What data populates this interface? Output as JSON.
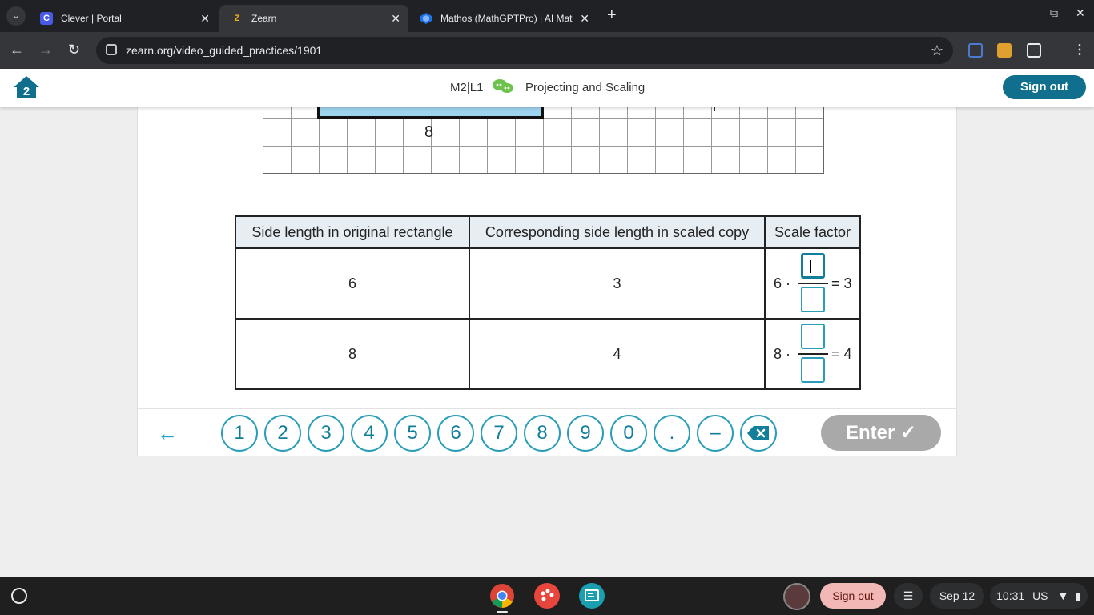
{
  "browser": {
    "tabs": [
      {
        "title": "Clever | Portal",
        "icon": "clever-icon",
        "active": false
      },
      {
        "title": "Zearn",
        "icon": "zearn-icon",
        "active": true
      },
      {
        "title": "Mathos (MathGPTPro) | AI Mat",
        "icon": "mathos-icon",
        "active": false
      }
    ],
    "url": "zearn.org/video_guided_practices/1901"
  },
  "header": {
    "lesson_code": "M2|L1",
    "lesson_title": "Projecting and Scaling",
    "sign_out": "Sign out"
  },
  "figure": {
    "bottom_label": "8"
  },
  "table": {
    "headers": [
      "Side length in original rectangle",
      "Corresponding side length in scaled copy",
      "Scale factor"
    ],
    "rows": [
      {
        "original": "6",
        "scaled": "3",
        "multiplier": "6 ·",
        "result": "= 3"
      },
      {
        "original": "8",
        "scaled": "4",
        "multiplier": "8 ·",
        "result": "= 4"
      }
    ]
  },
  "keypad": {
    "keys": [
      "1",
      "2",
      "3",
      "4",
      "5",
      "6",
      "7",
      "8",
      "9",
      "0",
      ".",
      "–"
    ],
    "enter_label": "Enter ✓"
  },
  "shelf": {
    "sign_out": "Sign out",
    "date": "Sep 12",
    "time": "10:31",
    "locale": "US"
  },
  "colors": {
    "accent": "#2a9db9",
    "accent_dark": "#117f99",
    "header_button": "#0f6f8c",
    "enter_disabled": "#a9a9a9",
    "rectangle_fill": "#9fd4f0"
  }
}
